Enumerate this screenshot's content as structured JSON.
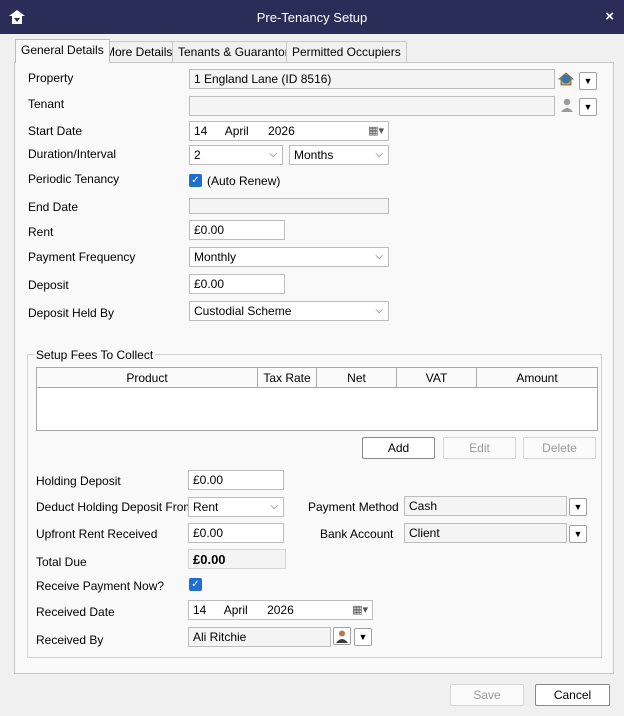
{
  "window": {
    "title": "Pre-Tenancy Setup",
    "close_symbol": "×"
  },
  "tabs": [
    {
      "label": "General Details",
      "active": true
    },
    {
      "label": "More Details"
    },
    {
      "label": "Tenants & Guarantors"
    },
    {
      "label": "Permitted Occupiers"
    }
  ],
  "labels": {
    "property": "Property",
    "tenant": "Tenant",
    "start_date": "Start Date",
    "duration": "Duration/Interval",
    "periodic": "Periodic Tenancy",
    "end_date": "End Date",
    "rent": "Rent",
    "payment_frequency": "Payment Frequency",
    "deposit": "Deposit",
    "deposit_held_by": "Deposit Held By"
  },
  "fields": {
    "property": "1 England Lane (ID 8516)",
    "tenant": "",
    "start_date": {
      "day": "14",
      "month": "April",
      "year": "2026"
    },
    "duration_value": "2",
    "duration_unit": "Months",
    "periodic_label": "(Auto Renew)",
    "periodic_checked": true,
    "end_date": "",
    "rent": "£0.00",
    "payment_frequency": "Monthly",
    "deposit": "£0.00",
    "deposit_held_by": "Custodial Scheme"
  },
  "fees": {
    "title": "Setup Fees To Collect",
    "columns": [
      "Product",
      "Tax Rate",
      "Net",
      "VAT",
      "Amount"
    ],
    "add": "Add",
    "edit": "Edit",
    "delete": "Delete"
  },
  "payment": {
    "holding_deposit_label": "Holding Deposit",
    "holding_deposit": "£0.00",
    "deduct_from_label": "Deduct Holding Deposit From",
    "deduct_from": "Rent",
    "payment_method_label": "Payment Method",
    "payment_method": "Cash",
    "upfront_rent_label": "Upfront Rent Received",
    "upfront_rent": "£0.00",
    "bank_account_label": "Bank Account",
    "bank_account": "Client",
    "total_due_label": "Total Due",
    "total_due": "£0.00",
    "receive_now_label": "Receive Payment Now?",
    "receive_now_checked": true,
    "received_date_label": "Received Date",
    "received_date": {
      "day": "14",
      "month": "April",
      "year": "2026"
    },
    "received_by_label": "Received By",
    "received_by": "Ali Ritchie"
  },
  "footer": {
    "save": "Save",
    "cancel": "Cancel"
  },
  "icons": {
    "app": "home-logo-icon",
    "property_lookup": "house-icon",
    "tenant_lookup": "person-icon",
    "calendar": "calendar-icon",
    "dropdown": "chevron-down-icon"
  },
  "colors": {
    "titlebar": "#2a2d57",
    "checkbox": "#1f6fcf"
  }
}
